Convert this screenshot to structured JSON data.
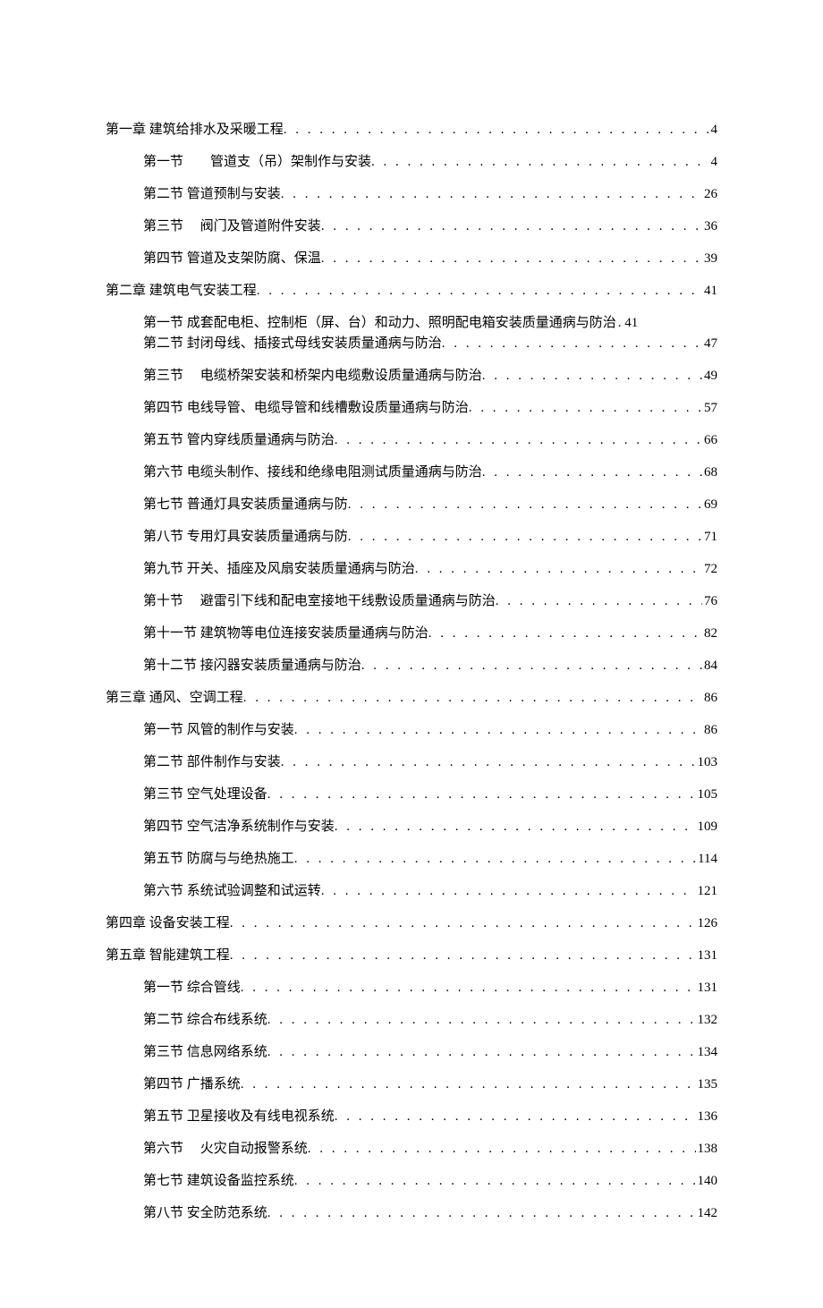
{
  "toc": [
    {
      "level": 1,
      "title": "第一章 建筑给排水及采暖工程",
      "page": "4"
    },
    {
      "level": 2,
      "title": "第一节　　管道支（吊）架制作与安装",
      "page": "4"
    },
    {
      "level": 2,
      "title": "第二节 管道预制与安装",
      "page": "26"
    },
    {
      "level": 2,
      "title": "第三节　 阀门及管道附件安装",
      "page": "36"
    },
    {
      "level": 2,
      "title": "第四节 管道及支架防腐、保温",
      "page": "39"
    },
    {
      "level": 1,
      "title": "第二章 建筑电气安装工程",
      "page": "41"
    },
    {
      "level": 2,
      "compound": true,
      "first_title": "第一节 成套配电柜、控制柜（屏、台）和动力、照明配电箱安装质量通病与防治",
      "first_page": ". 41",
      "second_title": "第二节 封闭母线、插接式母线安装质量通病与防治",
      "second_page": "47"
    },
    {
      "level": 2,
      "title": "第三节　 电缆桥架安装和桥架内电缆敷设质量通病与防治",
      "page": "49"
    },
    {
      "level": 2,
      "title": "第四节 电线导管、电缆导管和线槽敷设质量通病与防治",
      "page": "57"
    },
    {
      "level": 2,
      "title": "第五节 管内穿线质量通病与防治",
      "page": "66"
    },
    {
      "level": 2,
      "title": "第六节 电缆头制作、接线和绝缘电阻测试质量通病与防治",
      "page": "68"
    },
    {
      "level": 2,
      "title": "第七节 普通灯具安装质量通病与防",
      "page": "69"
    },
    {
      "level": 2,
      "title": "第八节 专用灯具安装质量通病与防",
      "page": "71"
    },
    {
      "level": 2,
      "title": "第九节 开关、插座及风扇安装质量通病与防治",
      "page": "72"
    },
    {
      "level": 2,
      "title": "第十节　 避雷引下线和配电室接地干线敷设质量通病与防治",
      "page": "76"
    },
    {
      "level": 2,
      "title": "第十一节 建筑物等电位连接安装质量通病与防治",
      "page": "82"
    },
    {
      "level": 2,
      "title": "第十二节 接闪器安装质量通病与防治",
      "page": "84"
    },
    {
      "level": 1,
      "title": "第三章 通风、空调工程",
      "page": "86"
    },
    {
      "level": 2,
      "title": "第一节 风管的制作与安装",
      "page": "86"
    },
    {
      "level": 2,
      "title": "第二节 部件制作与安装",
      "page": "103"
    },
    {
      "level": 2,
      "title": "第三节 空气处理设备",
      "page": "105"
    },
    {
      "level": 2,
      "title": "第四节 空气洁净系统制作与安装",
      "page": "109"
    },
    {
      "level": 2,
      "title": "第五节 防腐与与绝热施工",
      "page": "114"
    },
    {
      "level": 2,
      "title": "第六节 系统试验调整和试运转",
      "page": "121"
    },
    {
      "level": 1,
      "title": "第四章 设备安装工程",
      "page": "126"
    },
    {
      "level": 1,
      "title": "第五章 智能建筑工程",
      "page": "131"
    },
    {
      "level": 2,
      "title": "第一节 综合管线",
      "page": "131"
    },
    {
      "level": 2,
      "title": "第二节 综合布线系统",
      "page": "132"
    },
    {
      "level": 2,
      "title": "第三节 信息网络系统",
      "page": "134"
    },
    {
      "level": 2,
      "title": "第四节 广播系统",
      "page": "135"
    },
    {
      "level": 2,
      "title": "第五节 卫星接收及有线电视系统",
      "page": "136"
    },
    {
      "level": 2,
      "title": "第六节　 火灾自动报警系统",
      "page": "138"
    },
    {
      "level": 2,
      "title": "第七节 建筑设备监控系统",
      "page": "140"
    },
    {
      "level": 2,
      "title": "第八节 安全防范系统",
      "page": "142"
    }
  ]
}
